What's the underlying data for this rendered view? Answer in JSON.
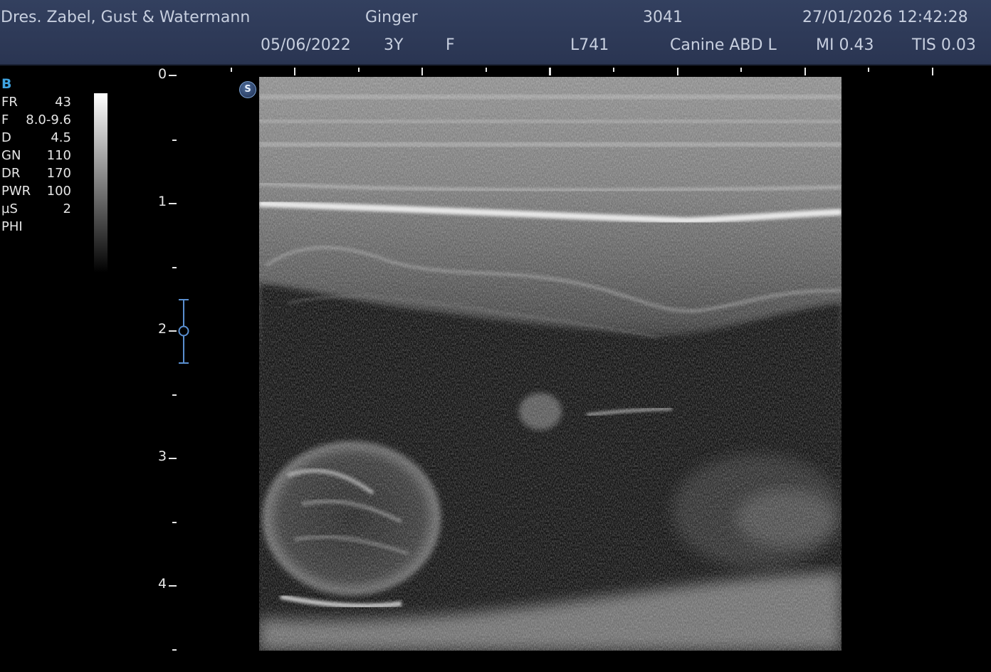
{
  "header": {
    "clinic": "Dres. Zabel, Gust & Watermann",
    "patient_name": "Ginger",
    "patient_id": "3041",
    "datetime": "27/01/2026 12:42:28",
    "birth_date": "05/06/2022",
    "age": "3Y",
    "sex": "F",
    "probe": "L741",
    "preset": "Canine ABD L",
    "mi": "MI 0.43",
    "tis": "TIS 0.03"
  },
  "params": {
    "mode": "B",
    "rows": [
      {
        "name": "FR",
        "value": "43"
      },
      {
        "name": "F",
        "value": "8.0-9.6"
      },
      {
        "name": "D",
        "value": "4.5"
      },
      {
        "name": "GN",
        "value": "110"
      },
      {
        "name": "DR",
        "value": "170"
      },
      {
        "name": "PWR",
        "value": "100"
      },
      {
        "name": "µS",
        "value": "2"
      },
      {
        "name": "PHI",
        "value": ""
      }
    ]
  },
  "depth_scale": {
    "labels": [
      "0",
      "1",
      "2",
      "3",
      "4"
    ]
  },
  "logo": {
    "letter": "S"
  },
  "colors": {
    "header_bg": "#2f3a57",
    "mode_accent": "#3fa3e0",
    "focus_marker": "#5a8fd0"
  }
}
